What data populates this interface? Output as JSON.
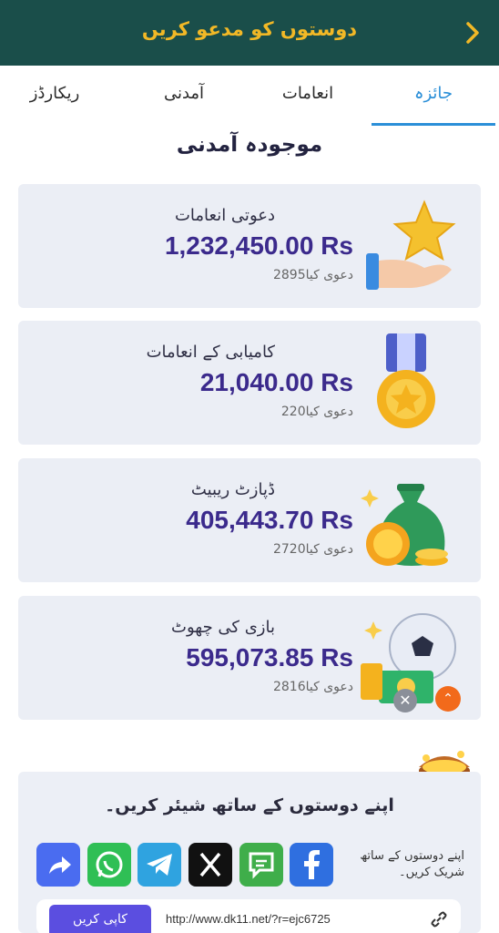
{
  "header": {
    "title": "دوستوں کو مدعو کریں",
    "back_icon": "chevron-right-icon"
  },
  "tabs": [
    {
      "label": "جائزہ",
      "active": true
    },
    {
      "label": "انعامات",
      "active": false
    },
    {
      "label": "آمدنی",
      "active": false
    },
    {
      "label": "ریکارڈز",
      "active": false
    }
  ],
  "section_title": "موجودہ آمدنی",
  "cards": [
    {
      "label": "دعوتی انعامات",
      "amount": "1,232,450.00 Rs",
      "count": "2895دعوی کیا",
      "icon": "star-hand-icon"
    },
    {
      "label": "کامیابی کے انعامات",
      "amount": "21,040.00 Rs",
      "count": "220دعوی کیا",
      "icon": "medal-icon"
    },
    {
      "label": "ڈپازٹ ریبیٹ",
      "amount": "405,443.70 Rs",
      "count": "2720دعوی کیا",
      "icon": "money-bag-icon"
    },
    {
      "label": "بازی کی چھوٹ",
      "amount": "595,073.85 Rs",
      "count": "2816دعوی کیا",
      "icon": "football-cash-icon"
    }
  ],
  "share": {
    "title": "اپنے دوستوں کے ساتھ شیئر کریں۔",
    "side_text": "اپنے دوستوں کے ساتھ شریک کریں۔",
    "copy_label": "کاپی کریں",
    "link": "http://www.dk11.net/?r=ejc6725"
  },
  "colors": {
    "header": "#1a4e4a",
    "accent": "#f2b826",
    "tab_active": "#2b8fd8",
    "amount": "#3b2a8c"
  }
}
